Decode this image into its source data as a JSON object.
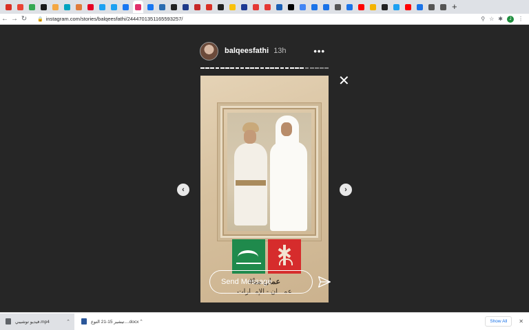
{
  "browser": {
    "tab_colors": [
      "#d93025",
      "#ea4335",
      "#34a853",
      "#1a1a1a",
      "#f4a742",
      "#00a3bf",
      "#e07b39",
      "#e60023",
      "#1da1f2",
      "#1da1f2",
      "#1877f2",
      "#e1306c",
      "#1877f2",
      "#2b6cb0",
      "#222",
      "#1e3a8a",
      "#c62828",
      "#d93025",
      "#222",
      "#f9c10b",
      "#1f3a93",
      "#e53935",
      "#e53935",
      "#1a5fb4",
      "#000",
      "#4285f4",
      "#1a73e8",
      "#1a73e8",
      "#555",
      "#1a73e8",
      "#ff0000",
      "#f4b400",
      "#222",
      "#1da1f2",
      "#ff0000",
      "#1a73e8",
      "#555",
      "#555"
    ],
    "new_tab_label": "+",
    "url": "instagram.com/stories/balqeesfathi/2444701351165593257/"
  },
  "story": {
    "username": "balqeesfathi",
    "time": "13h",
    "more_icon": "more-horizontal-icon",
    "progress": {
      "total": 26,
      "current": 21
    },
    "arabic_line1": "#عمان منا",
    "arabic_line2": "عمـــان - الإمــارات",
    "reply_placeholder": "Send Message"
  },
  "downloads": {
    "items": [
      {
        "name": "فيديو توشيبي.mp4",
        "icon_color": "#5f6368"
      },
      {
        "name": "تيشير 15-21 التوع....docx",
        "icon_color": "#2b579a"
      }
    ],
    "show_all": "Show All"
  }
}
